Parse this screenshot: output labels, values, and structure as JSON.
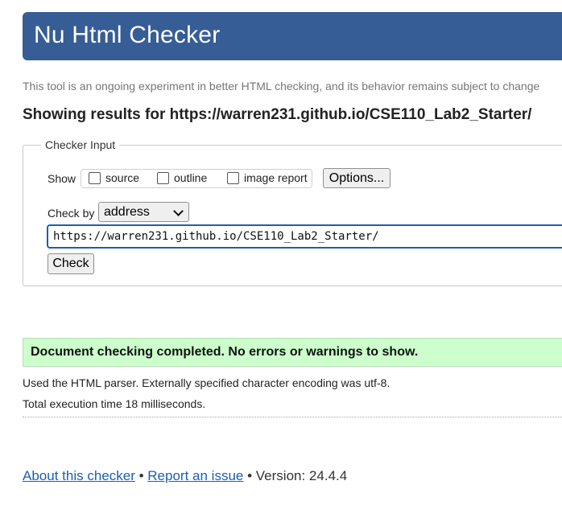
{
  "header": {
    "title": "Nu Html Checker"
  },
  "intro": "This tool is an ongoing experiment in better HTML checking, and its behavior remains subject to change",
  "results_heading": "Showing results for https://warren231.github.io/CSE110_Lab2_Starter/",
  "checker_input": {
    "legend": "Checker Input",
    "show_label": "Show",
    "show_options": [
      {
        "label": "source",
        "checked": false
      },
      {
        "label": "outline",
        "checked": false
      },
      {
        "label": "image report",
        "checked": false
      }
    ],
    "options_button": "Options...",
    "check_by_label": "Check by",
    "check_by_value": "address",
    "url_value": "https://warren231.github.io/CSE110_Lab2_Starter/",
    "check_button": "Check"
  },
  "result": {
    "message": "Document checking completed. No errors or warnings to show."
  },
  "info": {
    "parser": "Used the HTML parser. Externally specified character encoding was utf-8.",
    "execution_time": "Total execution time 18 milliseconds."
  },
  "footer": {
    "about_link": "About this checker",
    "separator": "•",
    "report_link": "Report an issue",
    "version": "Version: 24.4.4"
  },
  "colors": {
    "banner": "#365d95",
    "success_bg": "#ccffcc",
    "link": "#1a5fb4"
  }
}
